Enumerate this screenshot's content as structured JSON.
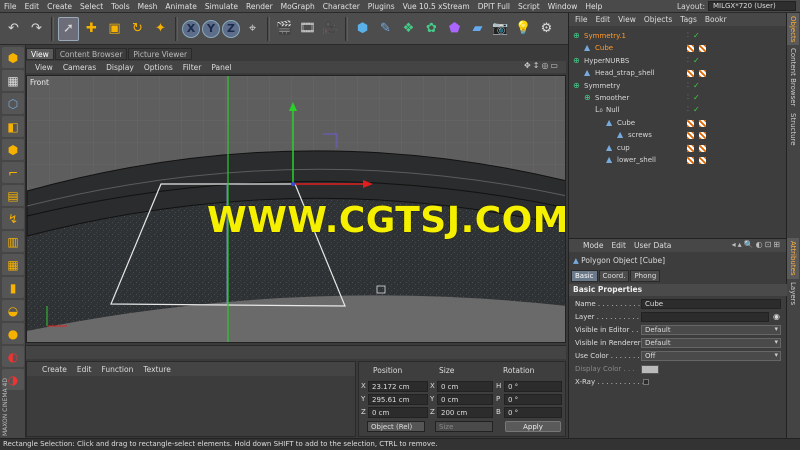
{
  "menubar": {
    "items": [
      "File",
      "Edit",
      "Create",
      "Select",
      "Tools",
      "Mesh",
      "Animate",
      "Simulate",
      "Render",
      "MoGraph",
      "Character",
      "Plugins",
      "Vue 10.5 xStream",
      "DPIT Full",
      "Script",
      "Window",
      "Help"
    ],
    "layout_label": "Layout:",
    "layout_value": "MILGX*720 (User)"
  },
  "toolbar": {
    "axes": [
      "X",
      "Y",
      "Z"
    ]
  },
  "viewport": {
    "tabs": [
      "View",
      "Content Browser",
      "Picture Viewer"
    ],
    "menu": [
      "View",
      "Cameras",
      "Display",
      "Options",
      "Filter",
      "Panel"
    ],
    "view_name": "Front",
    "watermark": "WWW.CGTSJ.COM"
  },
  "fcurve": {
    "menu": [
      "Create",
      "Edit",
      "Function",
      "Texture"
    ]
  },
  "coords": {
    "headers": [
      "Position",
      "Size",
      "Rotation"
    ],
    "rows": [
      {
        "axis": "X",
        "pos": "23.172 cm",
        "size_axis": "X",
        "size": "0 cm",
        "rot_axis": "H",
        "rot": "0 °"
      },
      {
        "axis": "Y",
        "pos": "295.61 cm",
        "size_axis": "Y",
        "size": "0 cm",
        "rot_axis": "P",
        "rot": "0 °"
      },
      {
        "axis": "Z",
        "pos": "0 cm",
        "size_axis": "Z",
        "size": "200 cm",
        "rot_axis": "B",
        "rot": "0 °"
      }
    ],
    "mode": "Object (Rel)",
    "size_mode": "Size",
    "apply_label": "Apply"
  },
  "status": {
    "text": "Rectangle Selection: Click and drag to rectangle-select elements. Hold down SHIFT to add to the selection, CTRL to remove."
  },
  "objects": {
    "menu": [
      "File",
      "Edit",
      "View",
      "Objects",
      "Tags",
      "Bookr"
    ],
    "items": [
      {
        "name": "Symmetry.1",
        "depth": 0,
        "icon": "symmetry-icon",
        "selected": true,
        "tag": false
      },
      {
        "name": "Cube",
        "depth": 1,
        "icon": "polygon-icon",
        "selected": true,
        "tag": true
      },
      {
        "name": "HyperNURBS",
        "depth": 0,
        "icon": "hypernurbs-icon",
        "selected": false,
        "tag": false
      },
      {
        "name": "Head_strap_shell",
        "depth": 1,
        "icon": "polygon-icon",
        "selected": false,
        "tag": true
      },
      {
        "name": "Symmetry",
        "depth": 0,
        "icon": "symmetry-icon",
        "selected": false,
        "tag": false
      },
      {
        "name": "Smoother",
        "depth": 1,
        "icon": "smoother-icon",
        "selected": false,
        "tag": false
      },
      {
        "name": "Null",
        "depth": 2,
        "icon": "null-icon",
        "selected": false,
        "tag": false
      },
      {
        "name": "Cube",
        "depth": 3,
        "icon": "polygon-icon",
        "selected": false,
        "tag": true
      },
      {
        "name": "screws",
        "depth": 4,
        "icon": "polygon-icon",
        "selected": false,
        "tag": true
      },
      {
        "name": "cup",
        "depth": 3,
        "icon": "polygon-icon",
        "selected": false,
        "tag": true
      },
      {
        "name": "lower_shell",
        "depth": 3,
        "icon": "polygon-icon",
        "selected": false,
        "tag": true
      }
    ]
  },
  "side_tabs_top": [
    "Objects",
    "Content Browser",
    "Structure"
  ],
  "side_tabs_bottom": [
    "Attributes",
    "Layers"
  ],
  "attributes": {
    "menu": [
      "Mode",
      "Edit",
      "User Data"
    ],
    "title": "Polygon Object [Cube]",
    "tabs": [
      "Basic",
      "Coord.",
      "Phong"
    ],
    "section": "Basic Properties",
    "rows": [
      {
        "label": "Name . . . . . . . . . . . .",
        "value": "Cube",
        "type": "text"
      },
      {
        "label": "Layer . . . . . . . . . . . .",
        "value": "",
        "type": "text"
      },
      {
        "label": "Visible in Editor . . .",
        "value": "Default",
        "type": "drop"
      },
      {
        "label": "Visible in Renderer",
        "value": "Default",
        "type": "drop"
      },
      {
        "label": "Use Color . . . . . . . .",
        "value": "Off",
        "type": "drop"
      },
      {
        "label": "Display Color . . .",
        "value": "",
        "type": "swatch"
      },
      {
        "label": "X-Ray . . . . . . . . . . .",
        "value": "",
        "type": "check"
      }
    ]
  }
}
